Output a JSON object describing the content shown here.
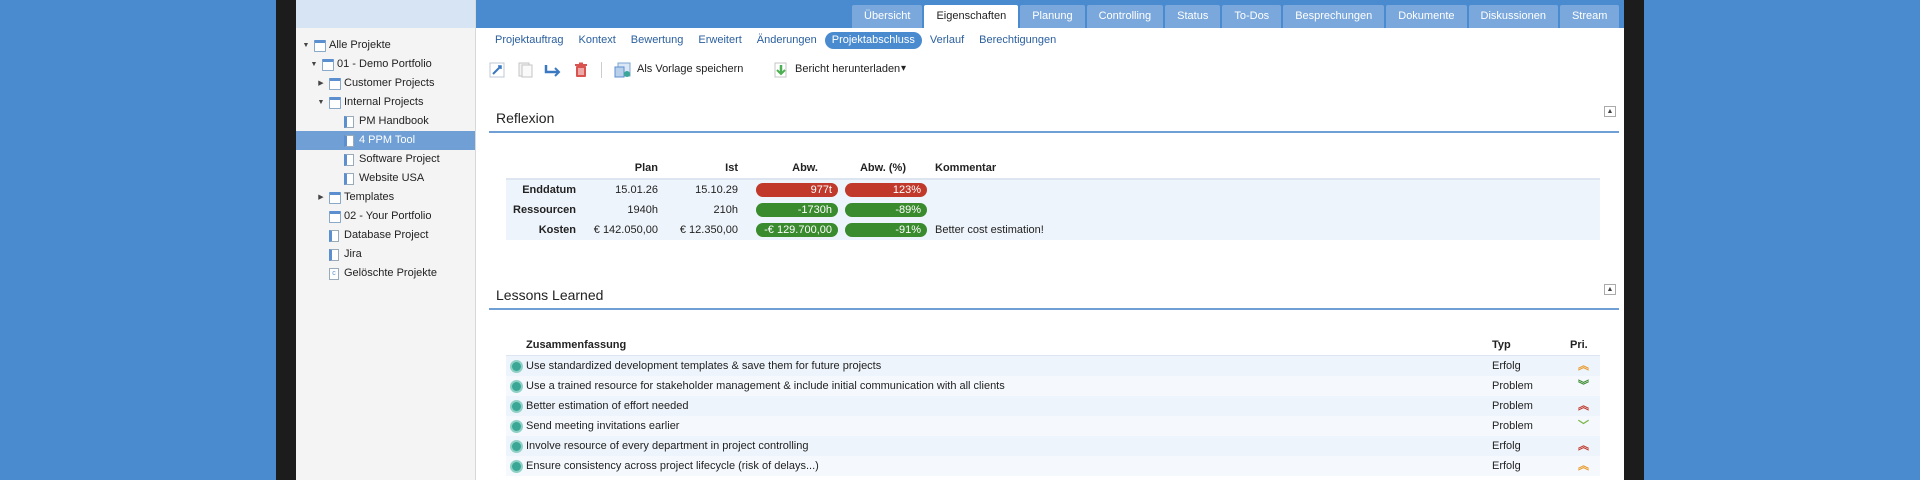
{
  "top_tabs": [
    "Übersicht",
    "Eigenschaften",
    "Planung",
    "Controlling",
    "Status",
    "To-Dos",
    "Besprechungen",
    "Dokumente",
    "Diskussionen",
    "Stream"
  ],
  "active_top_tab": "Eigenschaften",
  "sub_tabs": [
    "Projektauftrag",
    "Kontext",
    "Bewertung",
    "Erweitert",
    "Änderungen",
    "Projektabschluss",
    "Verlauf",
    "Berechtigungen"
  ],
  "active_sub_tab": "Projektabschluss",
  "tree": [
    {
      "label": "Alle Projekte",
      "icon": "portfolio-icon",
      "toggle": "▼"
    },
    {
      "label": "01 - Demo Portfolio",
      "icon": "portfolio-icon",
      "toggle": "▼"
    },
    {
      "label": "Customer Projects",
      "icon": "portfolio-icon",
      "toggle": "▶"
    },
    {
      "label": "Internal Projects",
      "icon": "portfolio-icon",
      "toggle": "▼"
    },
    {
      "label": "PM Handbook",
      "icon": "project-icon",
      "toggle": ""
    },
    {
      "label": "4 PPM Tool",
      "icon": "project-icon",
      "toggle": "",
      "selected": true
    },
    {
      "label": "Software Project",
      "icon": "project-icon",
      "toggle": ""
    },
    {
      "label": "Website USA",
      "icon": "project-icon",
      "toggle": ""
    },
    {
      "label": "Templates",
      "icon": "portfolio-icon",
      "toggle": "▶"
    },
    {
      "label": "02 - Your Portfolio",
      "icon": "portfolio-icon",
      "toggle": ""
    },
    {
      "label": "Database Project",
      "icon": "project-icon",
      "toggle": ""
    },
    {
      "label": "Jira",
      "icon": "project-icon",
      "toggle": ""
    },
    {
      "label": "Gelöschte Projekte",
      "icon": "trash-icon",
      "toggle": ""
    }
  ],
  "toolbar": {
    "save_template_label": "Als Vorlage speichern",
    "download_report_label": "Bericht herunterladen",
    "dropdown_glyph": "▾",
    "colors": {
      "delete": "#d9534f",
      "move": "#3b78c2"
    }
  },
  "reflexion": {
    "title": "Reflexion",
    "headers": {
      "plan": "Plan",
      "ist": "Ist",
      "abw": "Abw.",
      "abw_pct": "Abw. (%)",
      "kommentar": "Kommentar"
    },
    "rows": [
      {
        "label": "Enddatum",
        "plan": "15.01.26",
        "ist": "15.10.29",
        "abw": "977t",
        "abw_pct": "123%",
        "abw_color": "red",
        "kommentar": ""
      },
      {
        "label": "Ressourcen",
        "plan": "1940h",
        "ist": "210h",
        "abw": "-1730h",
        "abw_pct": "-89%",
        "abw_color": "green",
        "kommentar": ""
      },
      {
        "label": "Kosten",
        "plan": "€ 142.050,00",
        "ist": "€ 12.350,00",
        "abw": "-€ 129.700,00",
        "abw_pct": "-91%",
        "abw_color": "green",
        "kommentar": "Better cost estimation!"
      }
    ]
  },
  "lessons": {
    "title": "Lessons Learned",
    "headers": {
      "summary": "Zusammenfassung",
      "typ": "Typ",
      "pri": "Pri."
    },
    "rows": [
      {
        "summary": "Use standardized development templates & save them for future projects",
        "typ": "Erfolg",
        "pri_glyph": "︽",
        "pri_color": "#e89a2c"
      },
      {
        "summary": "Use a trained resource for stakeholder management & include initial communication with all clients",
        "typ": "Problem",
        "pri_glyph": "︾",
        "pri_color": "#3a8a2e"
      },
      {
        "summary": "Better estimation of effort needed",
        "typ": "Problem",
        "pri_glyph": "︽",
        "pri_color": "#c0392b"
      },
      {
        "summary": "Send meeting invitations earlier",
        "typ": "Problem",
        "pri_glyph": "﹀",
        "pri_color": "#7ab648"
      },
      {
        "summary": "Involve resource of every department in project controlling",
        "typ": "Erfolg",
        "pri_glyph": "︽",
        "pri_color": "#c0392b"
      },
      {
        "summary": "Ensure consistency across project lifecycle (risk of delays...)",
        "typ": "Erfolg",
        "pri_glyph": "︽",
        "pri_color": "#e89a2c"
      }
    ]
  }
}
